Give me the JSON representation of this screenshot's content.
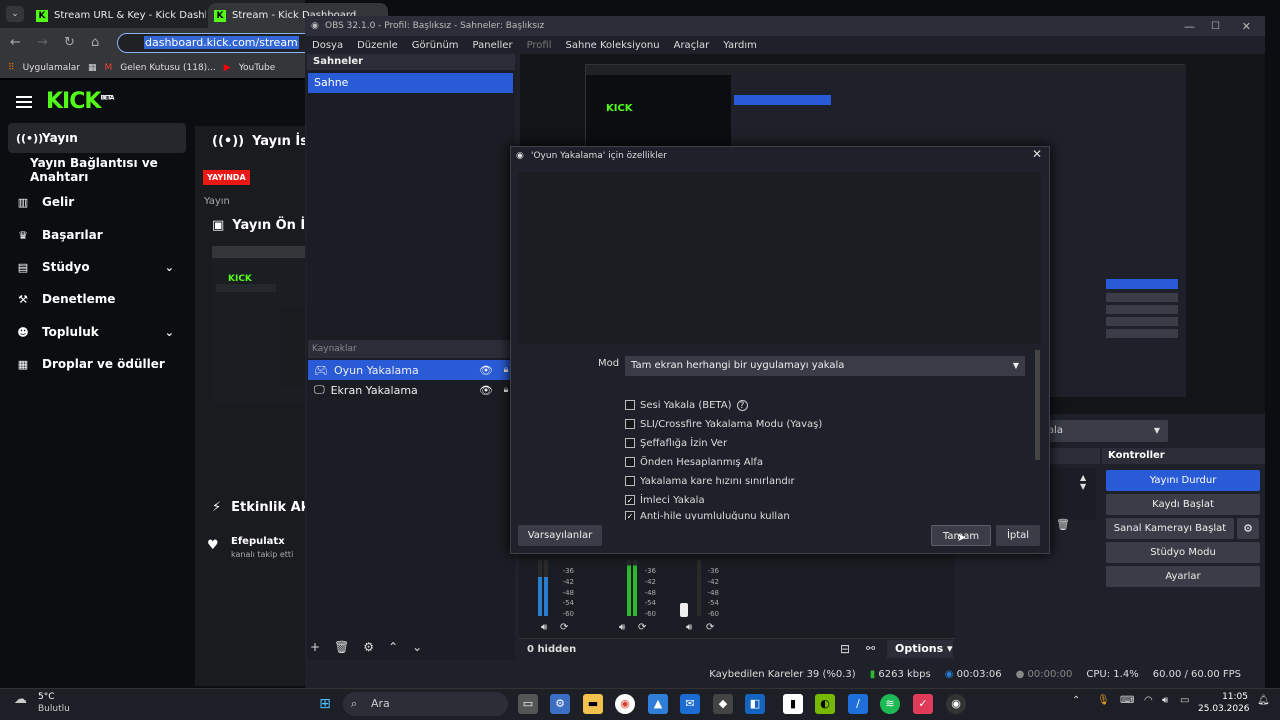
{
  "browser": {
    "tabs": [
      {
        "label": "Stream URL & Key - Kick Dashb"
      },
      {
        "label": "Stream - Kick Dashboard"
      }
    ],
    "address": "dashboard.kick.com/stream",
    "bookmarks": [
      "Uygulamalar",
      "Gelen Kutusu (118)...",
      "YouTube"
    ]
  },
  "kick": {
    "logo": "KICK",
    "logo_sup": "BETA",
    "nav": [
      {
        "label": "Yayın"
      },
      {
        "label": "Yayın Bağlantısı ve Anahtarı"
      },
      {
        "label": "Gelir"
      },
      {
        "label": "Başarılar"
      },
      {
        "label": "Stüdyo"
      },
      {
        "label": "Denetleme"
      },
      {
        "label": "Topluluk"
      },
      {
        "label": "Droplar ve ödüller"
      }
    ],
    "panel_stats_title": "Yayın İstat",
    "live_badge": "YAYINDA",
    "stream_label": "Yayın",
    "preview_title": "Yayın Ön İ",
    "activity_title": "Etkinlik Ak",
    "follower_name": "Efepulatx",
    "follower_msg": "kanalı takip etti"
  },
  "obs": {
    "title": "OBS 32.1.0 - Profil: Başlıksız - Sahneler: Başlıksız",
    "menu": [
      "Dosya",
      "Düzenle",
      "Görünüm",
      "Paneller",
      "Profil",
      "Sahne Koleksiyonu",
      "Araçlar",
      "Yardım"
    ],
    "scenes_header": "Sahneler",
    "scene_selected": "Sahne",
    "sources_header": "Kaynaklar",
    "sources": [
      {
        "label": "Oyun Yakalama"
      },
      {
        "label": "Ekran Yakalama"
      }
    ],
    "mixer_db": [
      "-36",
      "-42",
      "-48",
      "-54",
      "-60"
    ],
    "hidden_label": "0 hidden",
    "options_label": "Options",
    "transition_label": "ala",
    "controls_header": "Kontroller",
    "controls": [
      {
        "label": "Yayını Durdur"
      },
      {
        "label": "Kaydı Başlat"
      },
      {
        "label": "Sanal Kamerayı Başlat"
      },
      {
        "label": "Stüdyo Modu"
      },
      {
        "label": "Ayarlar"
      }
    ],
    "status": {
      "dropped": "Kaybedilen Kareler 39 (%0.3)",
      "bitrate": "6263 kbps",
      "stream_time": "00:03:06",
      "rec_time": "00:00:00",
      "cpu": "CPU: 1.4%",
      "fps": "60.00 / 60.00 FPS"
    }
  },
  "dialog": {
    "title": "'Oyun Yakalama' için özellikler",
    "mode_label": "Mod",
    "mode_value": "Tam ekran herhangi bir uygulamayı yakala",
    "options": [
      {
        "label": "Sesi Yakala (BETA)",
        "checked": false
      },
      {
        "label": "SLI/Crossfire Yakalama Modu (Yavaş)",
        "checked": false
      },
      {
        "label": "Şeffaflığa İzin Ver",
        "checked": false
      },
      {
        "label": "Önden Hesaplanmış Alfa",
        "checked": false
      },
      {
        "label": "Yakalama kare hızını sınırlandır",
        "checked": false
      },
      {
        "label": "İmleci Yakala",
        "checked": true
      },
      {
        "label": "Anti-hile uyumluluğunu kullan",
        "checked": true
      }
    ],
    "defaults_btn": "Varsayılanlar",
    "ok_btn": "Tamam",
    "cancel_btn": "İptal"
  },
  "taskbar": {
    "weather_temp": "5°C",
    "weather_desc": "Bulutlu",
    "search_placeholder": "Ara",
    "time": "11:05",
    "date": "25.03.2026"
  },
  "colors": {
    "kick_green": "#53fc18",
    "obs_blue": "#2a5bd7",
    "live_red": "#e91916"
  }
}
